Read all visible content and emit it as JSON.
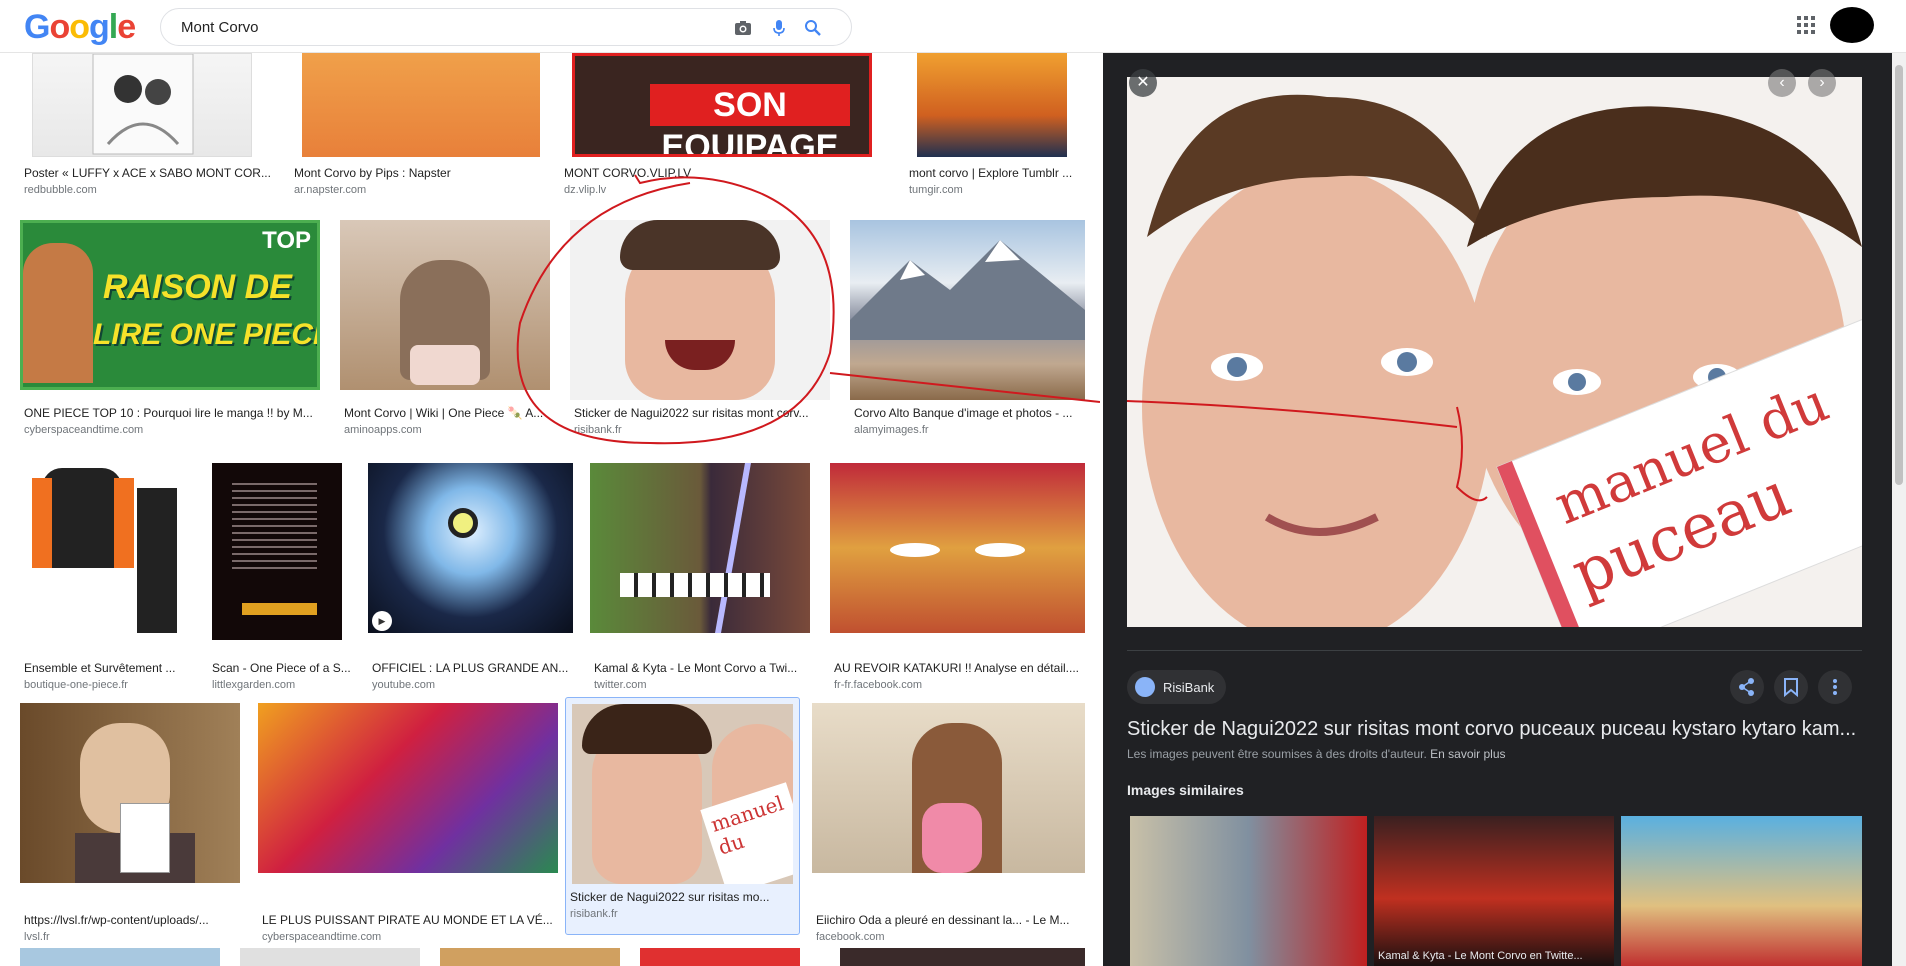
{
  "header": {
    "logo_letters": [
      "G",
      "o",
      "o",
      "g",
      "l",
      "e"
    ],
    "query": "Mont Corvo"
  },
  "results": [
    {
      "title": "Poster « LUFFY x ACE x SABO MONT COR...",
      "source": "redbubble.com"
    },
    {
      "title": "Mont Corvo by Pips : Napster",
      "source": "ar.napster.com"
    },
    {
      "title": "MONT CORVO.VLIP.LV",
      "source": "dz.vlip.lv"
    },
    {
      "title": "mont corvo | Explore Tumblr ...",
      "source": "tumgir.com"
    },
    {
      "title": "ONE PIECE TOP 10 : Pourquoi lire le manga !! by M...",
      "source": "cyberspaceandtime.com"
    },
    {
      "title": "Mont Corvo | Wiki | One Piece 🍡 A...",
      "source": "aminoapps.com"
    },
    {
      "title": "Sticker de Nagui2022 sur risitas mont corv...",
      "source": "risibank.fr"
    },
    {
      "title": "Corvo Alto Banque d'image et photos - ...",
      "source": "alamyimages.fr"
    },
    {
      "title": "Ensemble et Survêtement ...",
      "source": "boutique-one-piece.fr"
    },
    {
      "title": "Scan - One Piece of a S...",
      "source": "littlexgarden.com"
    },
    {
      "title": "OFFICIEL : LA PLUS GRANDE AN...",
      "source": "youtube.com"
    },
    {
      "title": "Kamal & Kyta - Le Mont Corvo a Twi...",
      "source": "twitter.com"
    },
    {
      "title": "AU REVOIR KATAKURI !! Analyse en détail....",
      "source": "fr-fr.facebook.com"
    },
    {
      "title": "https://lvsl.fr/wp-content/uploads/...",
      "source": "lvsl.fr"
    },
    {
      "title": "LE PLUS PUISSANT PIRATE AU MONDE ET LA VÉ...",
      "source": "cyberspaceandtime.com"
    },
    {
      "title": "Sticker de Nagui2022 sur risitas mo...",
      "source": "risibank.fr"
    },
    {
      "title": "Eiichiro Oda a pleuré en dessinant la... - Le M...",
      "source": "facebook.com"
    }
  ],
  "thumb_text": {
    "son_equipage": "SON EQUIPAGE",
    "raison_top": "TOP",
    "raison_1": "RAISON DE",
    "raison_2": "LIRE ONE PIECE",
    "manuel_1": "manuel du",
    "manuel_2": "puceau"
  },
  "panel": {
    "source_name": "RisiBank",
    "title": "Sticker de Nagui2022 sur risitas mont corvo puceaux puceau kystaro kytaro kam...",
    "copyright": "Les images peuvent être soumises à des droits d'auteur.",
    "learn_more": "En savoir plus",
    "similar_heading": "Images similaires",
    "similar_caption_2": "Kamal & Kyta - Le Mont Corvo en Twitte..."
  },
  "colors": {
    "panel_bg": "#202124",
    "annotation": "#d0191e",
    "selected_border": "#8ab4f8"
  }
}
